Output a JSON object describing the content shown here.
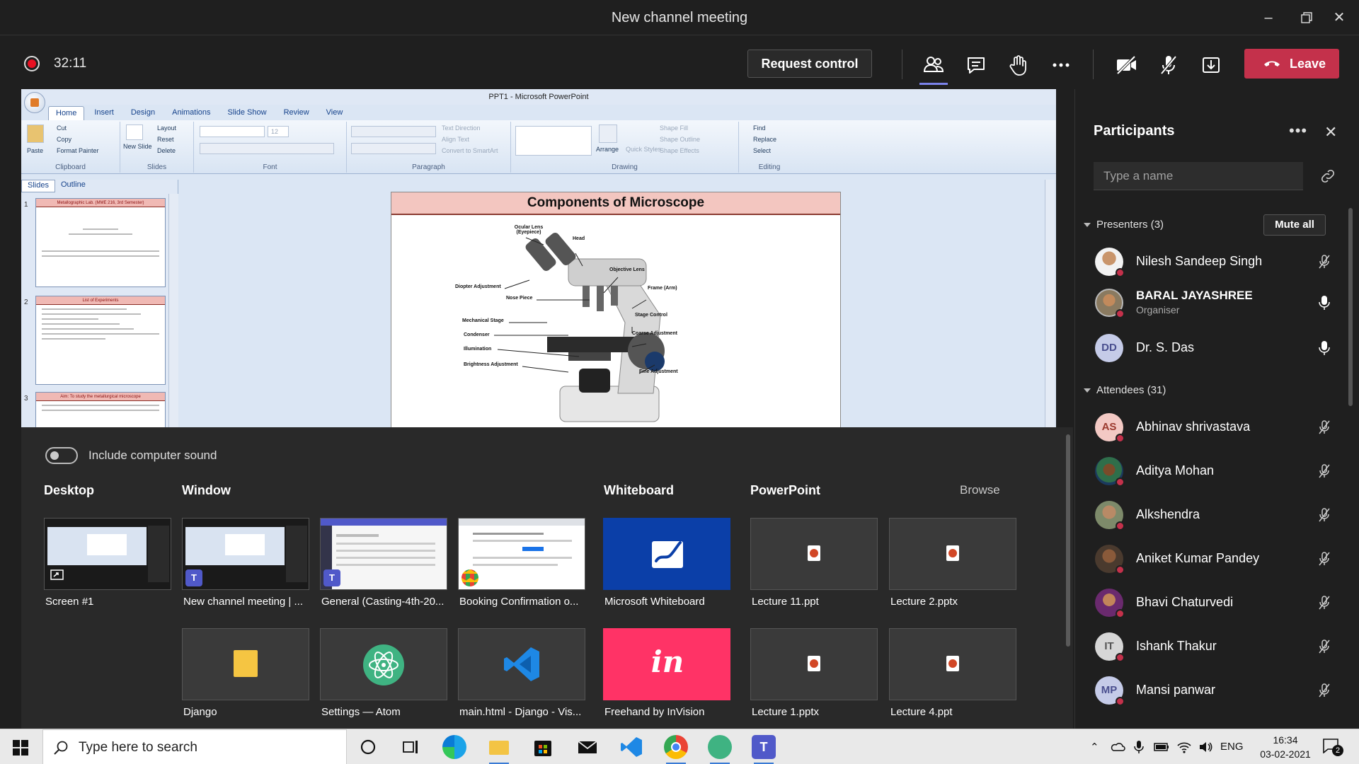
{
  "window": {
    "title": "New channel meeting"
  },
  "controls": {
    "timer": "32:11",
    "request_control": "Request control",
    "leave": "Leave"
  },
  "powerpoint": {
    "title": "PPT1 - Microsoft PowerPoint",
    "tabs": [
      "Home",
      "Insert",
      "Design",
      "Animations",
      "Slide Show",
      "Review",
      "View"
    ],
    "ribbon": {
      "clipboard": {
        "paste": "Paste",
        "cut": "Cut",
        "copy": "Copy",
        "format_painter": "Format Painter",
        "label": "Clipboard"
      },
      "slides": {
        "new_slide": "New Slide",
        "layout": "Layout",
        "reset": "Reset",
        "delete": "Delete",
        "label": "Slides"
      },
      "font": {
        "label": "Font",
        "size": "12"
      },
      "paragraph": {
        "text_direction": "Text Direction",
        "align_text": "Align Text",
        "convert": "Convert to SmartArt",
        "label": "Paragraph"
      },
      "drawing": {
        "arrange": "Arrange",
        "quick_styles": "Quick Styles",
        "shape_fill": "Shape Fill",
        "shape_outline": "Shape Outline",
        "shape_effects": "Shape Effects",
        "label": "Drawing"
      },
      "editing": {
        "find": "Find",
        "replace": "Replace",
        "select": "Select",
        "label": "Editing"
      }
    },
    "left_tabs": [
      "Slides",
      "Outline"
    ],
    "thumbnails": [
      {
        "num": "1",
        "header": "Metallographic Lab. (MME 216, 3rd Semester)"
      },
      {
        "num": "2",
        "header": "List of Experiments"
      },
      {
        "num": "3",
        "header": "Aim: To study the metallurgical microscope"
      }
    ],
    "slide": {
      "title": "Components of Microscope",
      "labels": [
        "Ocular Lens (Eyepiece)",
        "Head",
        "Objective Lens",
        "Diopter Adjustment",
        "Frame (Arm)",
        "Nose Piece",
        "Stage Control",
        "Mechanical Stage",
        "Coarse Adjustment",
        "Condenser",
        "Illumination",
        "Brightness Adjustment",
        "Fine Adjustment"
      ]
    }
  },
  "share_tray": {
    "include_sound": "Include computer sound",
    "sections": {
      "desktop": "Desktop",
      "window": "Window",
      "whiteboard": "Whiteboard",
      "powerpoint": "PowerPoint",
      "browse": "Browse"
    },
    "row1": [
      "Screen #1",
      "New channel meeting | ...",
      "General (Casting-4th-20...",
      "Booking Confirmation o...",
      "Microsoft Whiteboard",
      "Lecture 11.ppt",
      "Lecture 2.pptx"
    ],
    "row2": [
      "Django",
      "Settings — Atom",
      "main.html - Django - Vis...",
      "Freehand by InVision",
      "Lecture 1.pptx",
      "Lecture 4.ppt"
    ],
    "invision_text": "in"
  },
  "participants": {
    "title": "Participants",
    "search_placeholder": "Type a name",
    "presenters_label": "Presenters (3)",
    "mute_all": "Mute all",
    "attendees_label": "Attendees (31)",
    "presenters": [
      {
        "name": "Nilesh Sandeep Singh",
        "role": "",
        "initials": "",
        "mic": "muted"
      },
      {
        "name": "BARAL JAYASHREE",
        "role": "Organiser",
        "initials": "",
        "mic": "on"
      },
      {
        "name": "Dr. S. Das",
        "role": "",
        "initials": "DD",
        "mic": "on"
      }
    ],
    "attendees": [
      {
        "name": "Abhinav shrivastava",
        "initials": "AS",
        "mic": "muted"
      },
      {
        "name": "Aditya Mohan",
        "initials": "",
        "mic": "muted"
      },
      {
        "name": "Alkshendra",
        "initials": "",
        "mic": "muted"
      },
      {
        "name": "Aniket Kumar Pandey",
        "initials": "",
        "mic": "muted"
      },
      {
        "name": "Bhavi Chaturvedi",
        "initials": "",
        "mic": "muted"
      },
      {
        "name": "Ishank Thakur",
        "initials": "IT",
        "mic": "muted"
      },
      {
        "name": "Mansi panwar",
        "initials": "MP",
        "mic": "muted"
      }
    ]
  },
  "taskbar": {
    "search_placeholder": "Type here to search",
    "language": "ENG",
    "time": "16:34",
    "date": "03-02-2021",
    "notifications": "2"
  }
}
